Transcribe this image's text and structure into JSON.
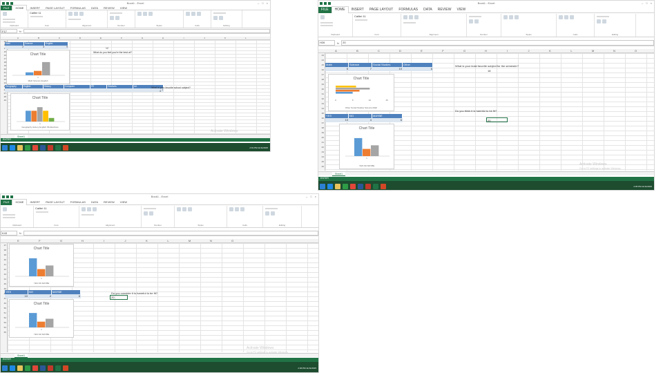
{
  "excel_common": {
    "qat_icons": [
      "save-icon",
      "undo-icon",
      "redo-icon"
    ],
    "tabs": [
      "FILE",
      "HOME",
      "INSERT",
      "PAGE LAYOUT",
      "FORMULAS",
      "DATA",
      "REVIEW",
      "VIEW"
    ],
    "ribbon_groups": [
      "Clipboard",
      "Font",
      "Alignment",
      "Number",
      "Styles",
      "Cells",
      "Editing"
    ],
    "font_name": "Calibri",
    "font_size": "11",
    "fx": "fx",
    "columns": [
      "A",
      "B",
      "C",
      "D",
      "E",
      "F",
      "G",
      "H",
      "I",
      "J",
      "K",
      "L",
      "M",
      "N",
      "O"
    ],
    "sheet_tab": "Sheet1",
    "status": "ENTER",
    "zoom": "100%",
    "activate_line1": "Activate Windows",
    "activate_line2": "Go to PC settings to activate Windows.",
    "chart_title": "Chart Title",
    "accent": "#217346",
    "table_header_color": "#4f81bd",
    "series_colors": [
      "#5b9bd5",
      "#ed7d31",
      "#a5a5a5",
      "#ffc000",
      "#70ad47"
    ]
  },
  "screen_top_left": {
    "window_title": "Book1 - Excel",
    "name_box": "F17",
    "formula_value": "",
    "row_numbers": [
      "12",
      "13",
      "14",
      "15",
      "16",
      "17",
      "18",
      "19",
      "20",
      "21",
      "22",
      "23",
      "24",
      "25",
      "26",
      "27",
      "28",
      "29"
    ],
    "clock": "2:01 PM\n11/11/2015",
    "question1": "What do you feel you're the best at?",
    "question2": "What is your favorite school subject?",
    "table1": {
      "headers": [
        "Math",
        "Science",
        "English"
      ],
      "values": [
        "2",
        "3",
        "9"
      ]
    },
    "table2": {
      "headers": [
        "Geography",
        "English",
        "History",
        "Computer",
        "PE",
        "Electives",
        "Art"
      ],
      "values": [
        "",
        "",
        "",
        "",
        "",
        "",
        "1"
      ]
    },
    "answer1": "12",
    "answer2": "4",
    "chart1_legend": "Math  Science  English",
    "chart2_legend": "Geography  History  English  PE  Electives"
  },
  "screen_top_right": {
    "window_title": "Book1 - Excel",
    "name_box": "H26",
    "formula_value": "20",
    "row_numbers": [
      "23",
      "24",
      "25",
      "26",
      "27",
      "28",
      "29",
      "30",
      "31",
      "32",
      "33",
      "34",
      "35",
      "36",
      "37",
      "38",
      "39",
      "40",
      "41",
      "42",
      "43",
      "44",
      "45",
      "46"
    ],
    "clock": "2:05 PM\n11/11/2015",
    "question1": "What is your least favorite subject for the semester?",
    "question2": "Do you think it is harmful to be fit?",
    "table1": {
      "headers": [
        "Math",
        "Science",
        "Social Studies",
        "Other"
      ],
      "values": [
        "5",
        "7",
        "10",
        "6"
      ]
    },
    "table2": {
      "headers": [
        "YES",
        "NO",
        "MAYBE"
      ],
      "values": [
        "10",
        "4",
        "6"
      ]
    },
    "answer1": "18",
    "answer2": "20",
    "chart1_legend": "Other  Social Studies  Science  Math",
    "chart2_legend": "YES  NO  MAYBE",
    "chart1_axis": [
      "0",
      "5",
      "10",
      "15"
    ]
  },
  "screen_bottom_left": {
    "window_title": "Book1 - Excel",
    "name_box": "K43",
    "formula_value": "",
    "row_numbers": [
      "37",
      "38",
      "39",
      "40",
      "41",
      "42",
      "43",
      "44",
      "45",
      "46",
      "47",
      "48",
      "49",
      "50",
      "51",
      "52",
      "53",
      "54",
      "55"
    ],
    "clock": "2:06 PM\n11/11/2015",
    "question1": "Do you consider it is harmful to be fit?",
    "table1": {
      "headers": [
        "YES",
        "NO",
        "MAYBE"
      ],
      "values": [
        "10",
        "4",
        "6"
      ]
    },
    "answer1": "20",
    "chart1_legend": "YES  NO  MAYBE",
    "chart2_legend": "YES  NO  MAYBE"
  },
  "chart_data": [
    {
      "type": "bar",
      "title": "Chart Title",
      "categories": [
        "1"
      ],
      "series": [
        {
          "name": "Math",
          "values": [
            2
          ]
        },
        {
          "name": "Science",
          "values": [
            3
          ]
        },
        {
          "name": "English",
          "values": [
            9
          ]
        }
      ]
    },
    {
      "type": "bar",
      "title": "Chart Title",
      "categories": [
        "1"
      ],
      "series": [
        {
          "name": "Geography",
          "values": [
            3
          ]
        },
        {
          "name": "History",
          "values": [
            3
          ]
        },
        {
          "name": "English",
          "values": [
            4
          ]
        },
        {
          "name": "PE",
          "values": [
            3
          ]
        },
        {
          "name": "Electives",
          "values": [
            1
          ]
        }
      ]
    },
    {
      "type": "bar",
      "title": "Chart Title",
      "categories": [
        "1"
      ],
      "series": [
        {
          "name": "Other",
          "values": [
            6
          ]
        },
        {
          "name": "Social Studies",
          "values": [
            10
          ]
        },
        {
          "name": "Science",
          "values": [
            7
          ]
        },
        {
          "name": "Math",
          "values": [
            5
          ]
        }
      ],
      "xlim": [
        0,
        15
      ]
    },
    {
      "type": "bar",
      "title": "Chart Title",
      "categories": [
        "1"
      ],
      "series": [
        {
          "name": "YES",
          "values": [
            10
          ]
        },
        {
          "name": "NO",
          "values": [
            4
          ]
        },
        {
          "name": "MAYBE",
          "values": [
            6
          ]
        }
      ]
    }
  ]
}
